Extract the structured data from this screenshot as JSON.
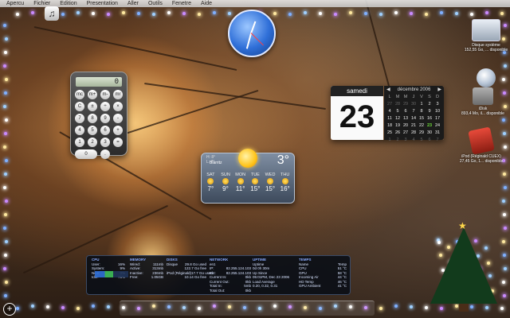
{
  "menubar": {
    "items": [
      "Apercu",
      "Fichier",
      "Edition",
      "Presentation",
      "Aller",
      "Outils",
      "Fenetre",
      "Aide"
    ]
  },
  "calculator": {
    "display": "0",
    "keys": [
      "mc",
      "m+",
      "m-",
      "mr",
      "C",
      "±",
      "÷",
      "×",
      "7",
      "8",
      "9",
      "-",
      "4",
      "5",
      "6",
      "+",
      "1",
      "2",
      "3",
      "=",
      "0",
      "."
    ]
  },
  "calendar": {
    "day_name": "samedi",
    "day_number": "23",
    "month_title": "décembre 2006",
    "weekdays": [
      "L",
      "M",
      "M",
      "J",
      "V",
      "S",
      "D"
    ],
    "weeks": [
      [
        "27",
        "28",
        "29",
        "30",
        "1",
        "2",
        "3"
      ],
      [
        "4",
        "5",
        "6",
        "7",
        "8",
        "9",
        "10"
      ],
      [
        "11",
        "12",
        "13",
        "14",
        "15",
        "16",
        "17"
      ],
      [
        "18",
        "19",
        "20",
        "21",
        "22",
        "23",
        "24"
      ],
      [
        "25",
        "26",
        "27",
        "28",
        "29",
        "30",
        "31"
      ],
      [
        "1",
        "2",
        "3",
        "4",
        "5",
        "6",
        "7"
      ]
    ],
    "today": "23",
    "accent": "#6ddc3a"
  },
  "weather": {
    "hilo": "H: 8°\nL: 7°",
    "city": "Biarritz",
    "current_temp": "3°",
    "days": [
      {
        "name": "SAT",
        "temp": "7°"
      },
      {
        "name": "SUN",
        "temp": "9°"
      },
      {
        "name": "MON",
        "temp": "11°"
      },
      {
        "name": "TUE",
        "temp": "15°"
      },
      {
        "name": "WED",
        "temp": "15°"
      },
      {
        "name": "THU",
        "temp": "16°"
      }
    ]
  },
  "istat": {
    "cpu": {
      "header": "CPU",
      "rows": [
        [
          "User:",
          "16%"
        ],
        [
          "System:",
          "9%"
        ],
        [
          "Nice:",
          "0%"
        ],
        [
          "Idle:",
          "75%"
        ]
      ]
    },
    "memory": {
      "header": "MEMORY",
      "rows": [
        [
          "Wired:",
          "111mb"
        ],
        [
          "Active:",
          "313mb"
        ],
        [
          "Inactive:",
          "236mb"
        ],
        [
          "Free:",
          "1.05GB"
        ]
      ]
    },
    "disks": {
      "header": "DISKS",
      "rows": [
        [
          "Disque",
          "29.8 Go used"
        ],
        [
          "",
          "122.7 Go free"
        ],
        [
          "iPod (Réginald)",
          "17.7 Go used"
        ],
        [
          "",
          "10.14 Go free"
        ]
      ]
    },
    "network": {
      "header": "NETWORK",
      "rows": [
        [
          "en1",
          ""
        ],
        [
          "IP:",
          "82.255.124.103"
        ],
        [
          "Ext:",
          "82.255.124.103"
        ],
        [
          "Current In:",
          "0kb"
        ],
        [
          "Current Out:",
          "0kb"
        ],
        [
          "Total In:",
          "5mb"
        ],
        [
          "Total Out:",
          "0kb"
        ]
      ]
    },
    "uptime": {
      "header": "UPTIME",
      "rows": [
        [
          "Uptime",
          ""
        ],
        [
          "0d 0h 30m",
          ""
        ],
        [
          "Up Since",
          ""
        ],
        [
          "05:01PM, Dec 23 2006",
          ""
        ],
        [
          "Load Average",
          ""
        ],
        [
          "0.20, 0.32, 0.31",
          ""
        ]
      ]
    },
    "temps": {
      "header": "TEMPS",
      "rows": [
        [
          "Name",
          "Temp"
        ],
        [
          "CPU",
          "51 °C"
        ],
        [
          "GPU",
          "58 °C"
        ],
        [
          "Incoming Air",
          "44 °C"
        ],
        [
          "HD Temp",
          "46 °C"
        ],
        [
          "GPU Ambient",
          "41 °C"
        ]
      ]
    }
  },
  "desktop_icons": [
    {
      "label": "Disque système",
      "sub": "152,55 Go, ... disponible"
    },
    {
      "label": "iDisk",
      "sub": "893,4 Mo, il... disponible"
    },
    {
      "label": "iPod (Réginald CUEX)",
      "sub": "27,45 Go, 1... disponible"
    }
  ],
  "dashboard_button": "+"
}
